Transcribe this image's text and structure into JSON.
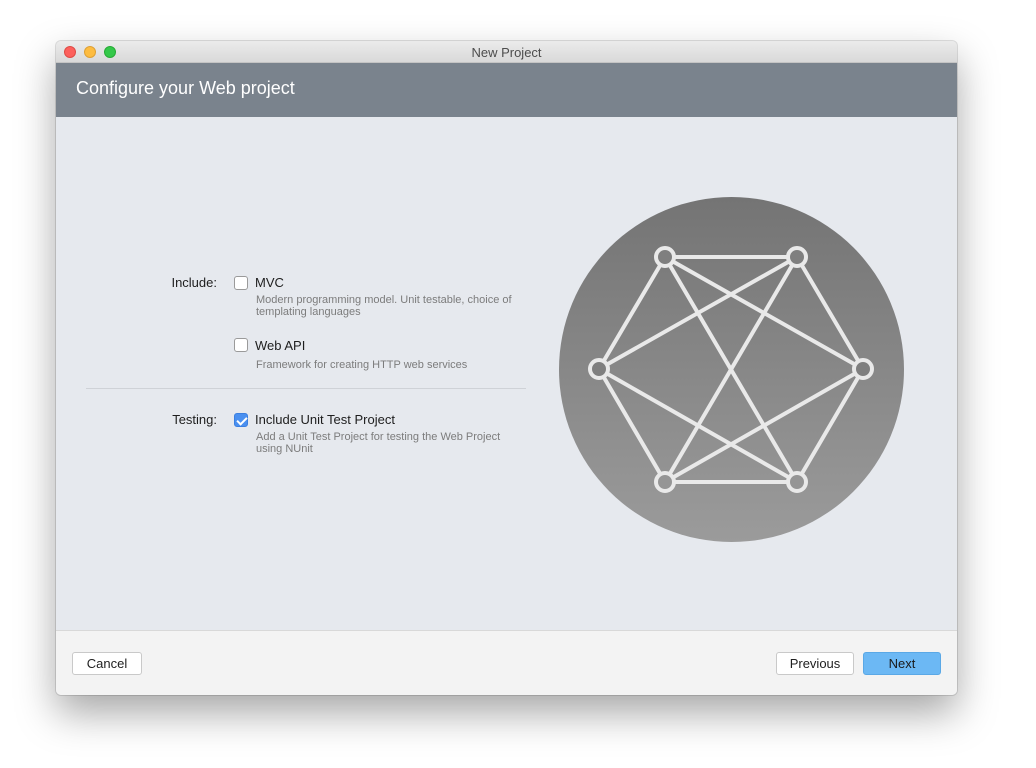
{
  "window": {
    "title": "New Project",
    "header_title": "Configure your Web project"
  },
  "include": {
    "label": "Include:",
    "options": [
      {
        "label": "MVC",
        "checked": false,
        "description": "Modern programming model. Unit testable, choice of templating languages"
      },
      {
        "label": "Web API",
        "checked": false,
        "description": "Framework for creating HTTP web services"
      }
    ]
  },
  "testing": {
    "label": "Testing:",
    "option": {
      "label": "Include Unit Test Project",
      "checked": true,
      "description": "Add a Unit Test Project for testing the Web Project using NUnit"
    }
  },
  "illustration": {
    "icon": "network-graph-icon"
  },
  "footer": {
    "cancel_label": "Cancel",
    "previous_label": "Previous",
    "next_label": "Next"
  },
  "colors": {
    "header_bg": "#7a838d",
    "content_bg": "#e6e9ee",
    "accent": "#4a90f0",
    "primary_button": "#6cb8f4"
  }
}
